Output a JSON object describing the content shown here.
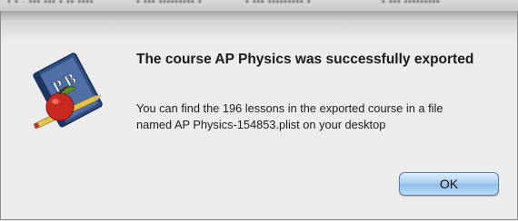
{
  "dialog": {
    "title": "The course AP Physics was successfully exported",
    "message": "You can find the 196 lessons in the exported course in a file named AP Physics-154853.plist on your desktop",
    "icon": "book-apple-app-icon",
    "ok_label": "OK"
  },
  "colors": {
    "background": "#ececec",
    "button_blue": "#a9cdf2"
  }
}
